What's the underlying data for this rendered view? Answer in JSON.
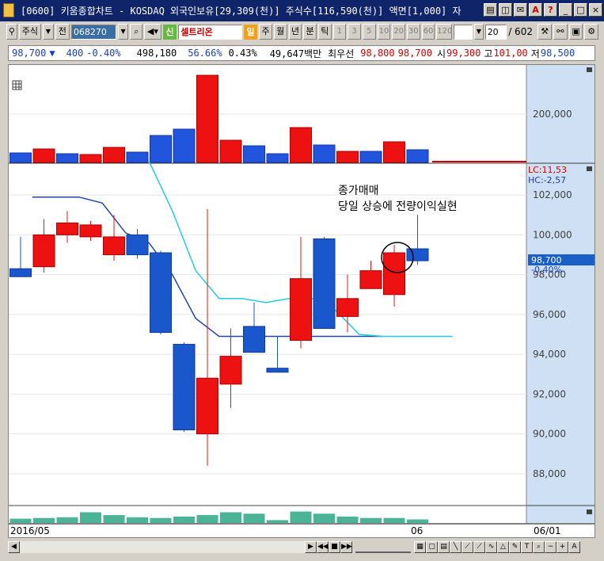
{
  "window": {
    "title": "[0600] 키움종합차트 - KOSDAQ 외국인보유[29,309(천)] 주식수[116,590(천)] 액면[1,000] 자",
    "buttons": [
      "▤",
      "◫",
      "✉",
      "A",
      "?",
      "_",
      "□",
      "×"
    ]
  },
  "toolbar": {
    "type_label": "주식",
    "all_label": "전",
    "code": "068270",
    "sin_label": "신",
    "stock_name": "셀트리온",
    "day_label": "일",
    "periods": [
      "주",
      "월",
      "년",
      "분",
      "틱"
    ],
    "numbers": [
      "1",
      "3",
      "5",
      "10",
      "20",
      "30",
      "60",
      "120"
    ],
    "count": "20",
    "total": "/ 602"
  },
  "quote": {
    "price": "98,700",
    "change": "400",
    "change_pct": "-0.40%",
    "volume": "498,180",
    "ratio": "56.66%",
    "turnover": "0.43%",
    "amount": "49,647백만",
    "best_label": "최우선",
    "best_ask": "98,800",
    "best_bid": "98,700",
    "open_label": "시",
    "open": "99,300",
    "high_label": "고",
    "high": "101,00",
    "low_label": "저",
    "low": "98,500"
  },
  "annotation": {
    "line1": "종가매매",
    "line2": "당일 상승에 전량이익실현"
  },
  "indicator": {
    "lc": "LC:11,53",
    "hc": "HC:-2,57",
    "price_tag": "98,700",
    "pct_tag": "-0.40%"
  },
  "xaxis": {
    "start": "2016/05",
    "mid": "06",
    "end": "06/01"
  },
  "chart_data": {
    "type": "candlestick",
    "yaxis_labels": [
      "200,000",
      "102,000",
      "100,000",
      "98,000",
      "96,000",
      "94,000",
      "92,000",
      "90,000",
      "88,000"
    ],
    "price_ylim": [
      86400,
      103600
    ],
    "candles": [
      {
        "o": 98300,
        "c": 97900,
        "h": 99900,
        "l": 97900
      },
      {
        "o": 98400,
        "c": 100000,
        "h": 100800,
        "l": 98100
      },
      {
        "o": 100000,
        "c": 100600,
        "h": 101200,
        "l": 99600
      },
      {
        "o": 99900,
        "c": 100500,
        "h": 100700,
        "l": 99700
      },
      {
        "o": 99000,
        "c": 99900,
        "h": 101000,
        "l": 98700
      },
      {
        "o": 100000,
        "c": 99000,
        "h": 100300,
        "l": 98800
      },
      {
        "o": 99100,
        "c": 95100,
        "h": 99200,
        "l": 95000
      },
      {
        "o": 94500,
        "c": 90200,
        "h": 94600,
        "l": 90100
      },
      {
        "o": 90000,
        "c": 92800,
        "h": 101300,
        "l": 88400
      },
      {
        "o": 92500,
        "c": 93900,
        "h": 95300,
        "l": 91300
      },
      {
        "o": 95400,
        "c": 94100,
        "h": 96600,
        "l": 94100
      },
      {
        "o": 93300,
        "c": 93100,
        "h": 94900,
        "l": 93100
      },
      {
        "o": 94700,
        "c": 97800,
        "h": 99900,
        "l": 94300
      },
      {
        "o": 99800,
        "c": 95300,
        "h": 99900,
        "l": 95300
      },
      {
        "o": 95900,
        "c": 96800,
        "h": 98000,
        "l": 95100
      },
      {
        "o": 97300,
        "c": 98200,
        "h": 98700,
        "l": 97300
      },
      {
        "o": 97000,
        "c": 99100,
        "h": 99500,
        "l": 96400
      },
      {
        "o": 99300,
        "c": 98700,
        "h": 101000,
        "l": 98500
      }
    ],
    "ma_dark": [
      101900,
      101900,
      101900,
      101600,
      100100,
      99600,
      98000,
      95800,
      94900,
      94900,
      94900,
      94900,
      94900,
      94900,
      94900,
      94900
    ],
    "ma_light": [
      103700,
      101200,
      98200,
      96800,
      96800,
      96600,
      96800,
      96800,
      96200,
      95000,
      94900,
      94900,
      94900,
      94900
    ],
    "volume_top": [
      {
        "v": 12,
        "up": false
      },
      {
        "v": 17,
        "up": true
      },
      {
        "v": 11,
        "up": false
      },
      {
        "v": 10,
        "up": true
      },
      {
        "v": 19,
        "up": true
      },
      {
        "v": 13,
        "up": false
      },
      {
        "v": 34,
        "up": false
      },
      {
        "v": 42,
        "up": false
      },
      {
        "v": 110,
        "up": true
      },
      {
        "v": 28,
        "up": true
      },
      {
        "v": 21,
        "up": false
      },
      {
        "v": 11,
        "up": false
      },
      {
        "v": 44,
        "up": true
      },
      {
        "v": 22,
        "up": false
      },
      {
        "v": 14,
        "up": true
      },
      {
        "v": 14,
        "up": false
      },
      {
        "v": 26,
        "up": true
      },
      {
        "v": 16,
        "up": false
      }
    ],
    "volume_bottom": [
      6,
      7,
      8,
      15,
      11,
      8,
      7,
      9,
      11,
      15,
      13,
      4,
      16,
      13,
      9,
      7,
      7,
      5
    ]
  }
}
